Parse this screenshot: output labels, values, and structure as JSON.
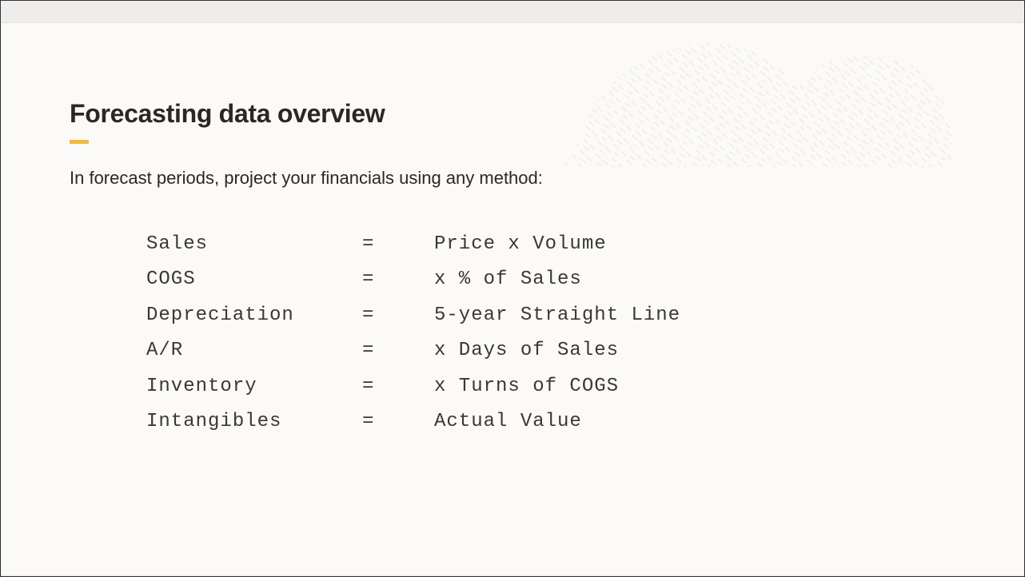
{
  "slide": {
    "title": "Forecasting data overview",
    "intro": "In forecast periods, project your financials using any method:",
    "formulas": [
      {
        "name": "Sales",
        "eq": "=",
        "value": "Price x Volume"
      },
      {
        "name": "COGS",
        "eq": "=",
        "value": "x % of Sales"
      },
      {
        "name": "Depreciation",
        "eq": "=",
        "value": "5-year Straight Line"
      },
      {
        "name": "A/R",
        "eq": "=",
        "value": "x Days of Sales"
      },
      {
        "name": "Inventory",
        "eq": "=",
        "value": "x Turns of COGS"
      },
      {
        "name": "Intangibles",
        "eq": "=",
        "value": "Actual Value"
      }
    ]
  }
}
